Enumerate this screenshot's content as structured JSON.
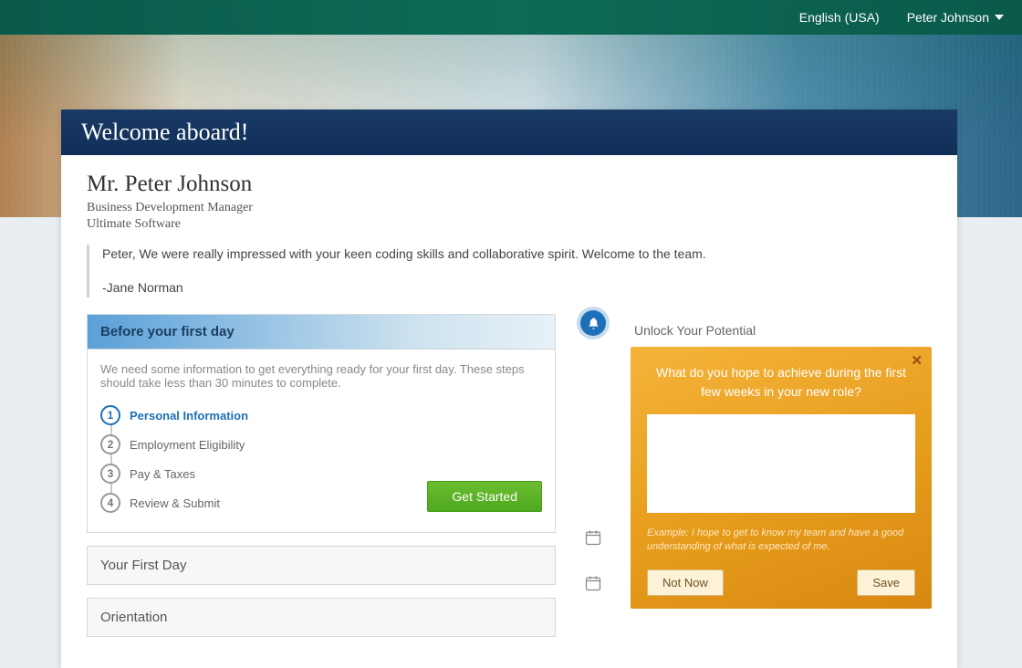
{
  "topbar": {
    "language": "English (USA)",
    "user_name": "Peter Johnson"
  },
  "welcome_title": "Welcome aboard!",
  "employee": {
    "name": "Mr. Peter Johnson",
    "title": "Business Development Manager",
    "company": "Ultimate Software"
  },
  "quote": {
    "text": "Peter, We were really impressed with your keen coding skills and collaborative spirit. Welcome to the team.",
    "signature": "-Jane Norman"
  },
  "before_panel": {
    "title": "Before your first day",
    "intro": "We need some information to get everything ready for your first day. These steps should take less than 30 minutes to complete.",
    "steps": [
      "Personal Information",
      "Employment Eligibility",
      "Pay & Taxes",
      "Review & Submit"
    ],
    "cta": "Get Started"
  },
  "collapsed_panels": [
    "Your First Day",
    "Orientation"
  ],
  "potential": {
    "heading": "Unlock Your Potential",
    "question": "What do you hope to achieve during the first few weeks in your new role?",
    "example": "Example: I hope to get to know my team and have a good understanding of what is expected of me.",
    "not_now": "Not Now",
    "save": "Save"
  }
}
